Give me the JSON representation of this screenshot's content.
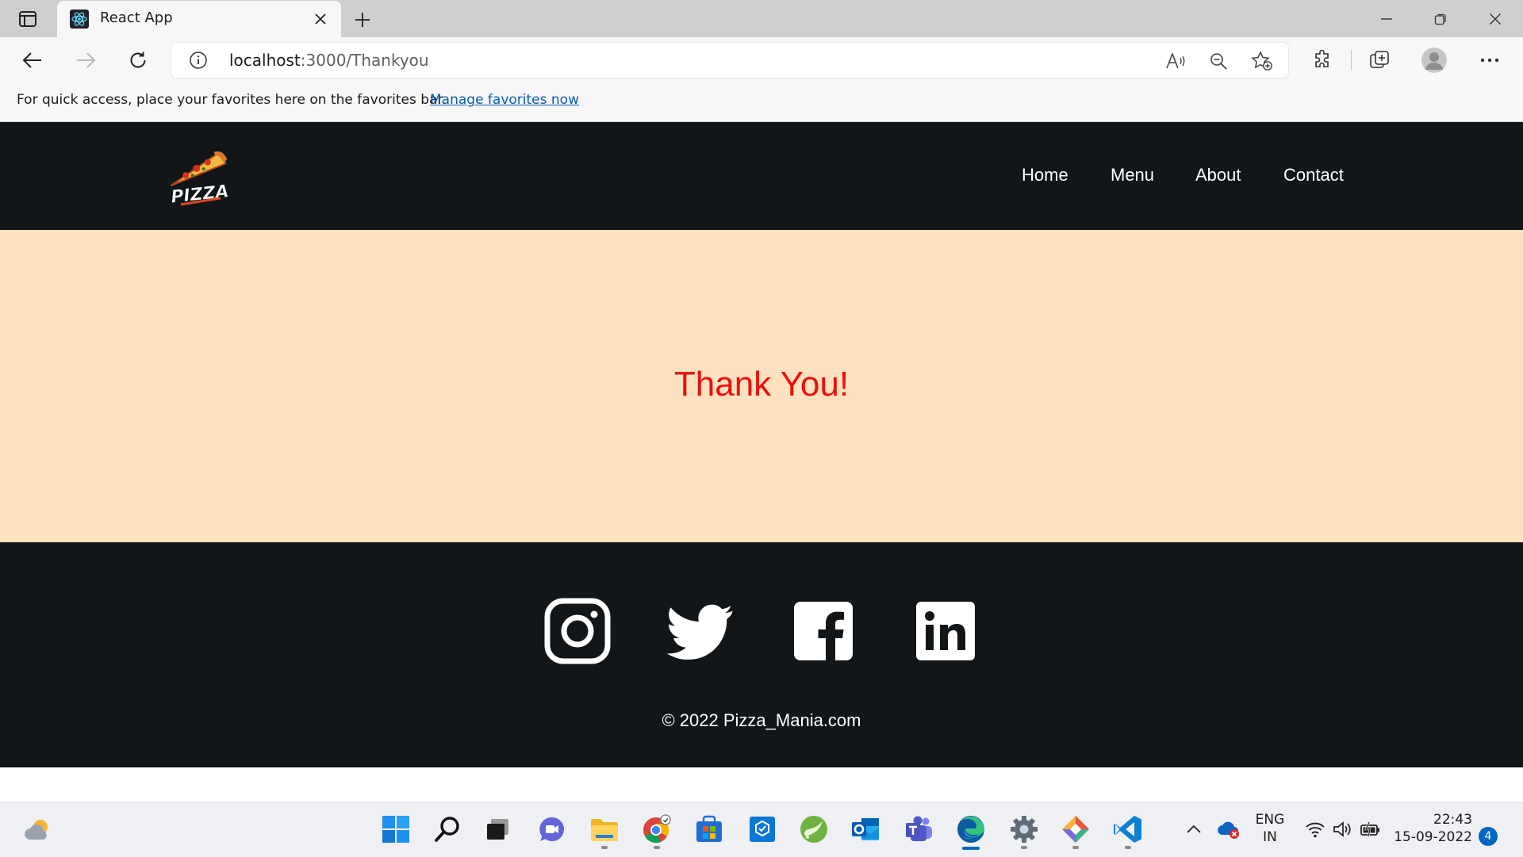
{
  "browser": {
    "tab_title": "React App",
    "url_host": "localhost",
    "url_path": ":3000/Thankyou",
    "favorites_prompt": "For quick access, place your favorites here on the favorites bar.",
    "favorites_link": "Manage favorites now"
  },
  "site": {
    "logo_text": "PIZZA",
    "nav": [
      "Home",
      "Menu",
      "About",
      "Contact"
    ],
    "hero_message": "Thank You!",
    "social_icons": [
      "instagram-icon",
      "twitter-icon",
      "facebook-icon",
      "linkedin-icon"
    ],
    "copyright": "© 2022 Pizza_Mania.com",
    "colors": {
      "header_bg": "#131619",
      "hero_bg": "#fde2c0",
      "message": "#ee0e0e",
      "text": "#ffffff"
    }
  },
  "taskbar": {
    "apps": [
      "start",
      "search",
      "task-view",
      "chat",
      "file-explorer",
      "chrome",
      "microsoft-store",
      "company-portal",
      "spring-tool-suite",
      "outlook",
      "teams",
      "edge",
      "settings",
      "sourcetree",
      "vscode"
    ],
    "language_line1": "ENG",
    "language_line2": "IN",
    "time": "22:43",
    "date": "15-09-2022",
    "notification_count": "4"
  }
}
